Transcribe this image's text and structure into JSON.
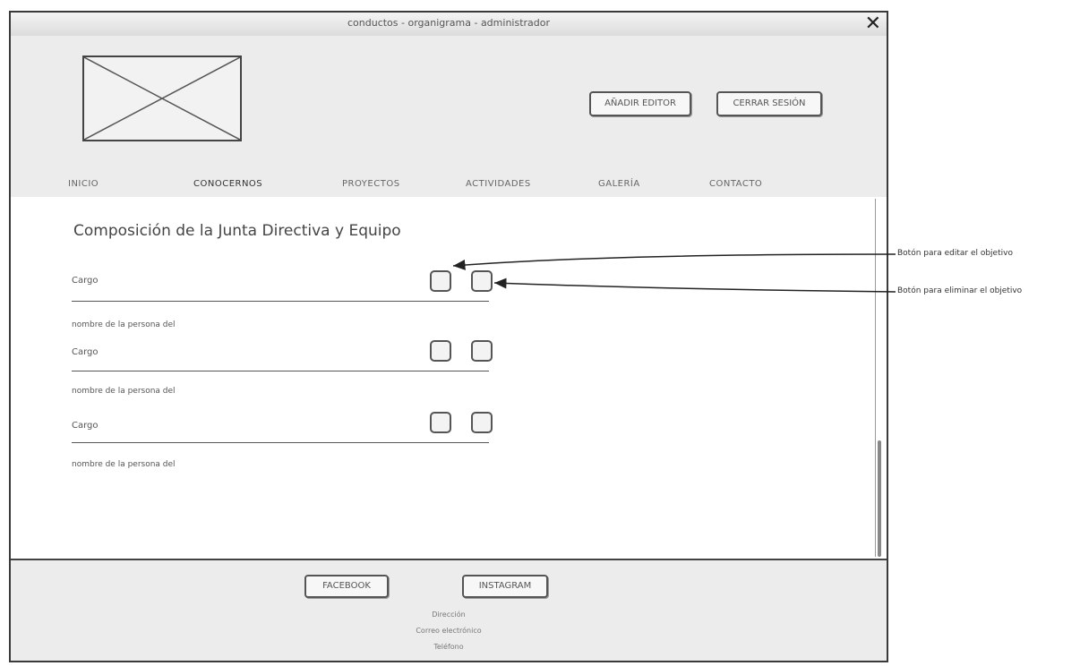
{
  "window": {
    "title": "conductos - organigrama - administrador",
    "close_glyph": "✕"
  },
  "header": {
    "logo": "image-placeholder",
    "buttons": {
      "add_editor": "AÑADIR EDITOR",
      "logout": "CERRAR SESIÓN"
    },
    "nav": [
      "INICIO",
      "CONOCERNOS",
      "PROYECTOS",
      "ACTIVIDADES",
      "GALERÍA",
      "CONTACTO"
    ]
  },
  "main": {
    "heading": "Composición de la Junta Directiva y Equipo",
    "rows": [
      {
        "cargo": "Cargo",
        "person": "nombre de la persona del"
      },
      {
        "cargo": "Cargo",
        "person": "nombre de la persona del"
      },
      {
        "cargo": "Cargo",
        "person": "nombre de la persona del"
      }
    ]
  },
  "footer": {
    "facebook": "FACEBOOK",
    "instagram": "INSTAGRAM",
    "links": [
      "Dirección",
      "Correo electrónico",
      "Teléfono"
    ]
  },
  "annotations": {
    "edit": "Botón para editar el objetivo",
    "delete": "Botón para eliminar el objetivo"
  },
  "colors": {
    "border": "#444444",
    "header_bg": "#ececec",
    "content_bg": "#ffffff"
  }
}
